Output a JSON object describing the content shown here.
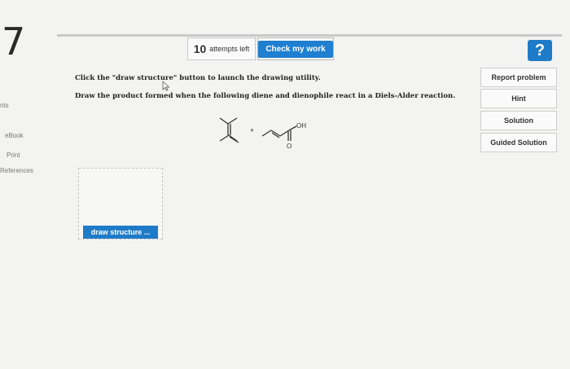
{
  "question": {
    "number": "7"
  },
  "toolbar": {
    "attempts_count": "10",
    "attempts_label": "attempts left",
    "check_label": "Check my work",
    "help_label": "?"
  },
  "sidebar": {
    "items": [
      {
        "label": "nts"
      },
      {
        "label": "eBook"
      },
      {
        "label": "Print"
      },
      {
        "label": "References"
      }
    ]
  },
  "instructions": {
    "line1": "Click the \"draw structure\" button to launch the drawing utility.",
    "line2": "Draw the product formed when the following diene and dienophile react in a Diels-Alder reaction."
  },
  "reaction": {
    "plus": "+",
    "oh_label": "OH",
    "o_label": "O"
  },
  "right_panel": {
    "buttons": [
      {
        "label": "Report problem"
      },
      {
        "label": "Hint"
      },
      {
        "label": "Solution"
      },
      {
        "label": "Guided Solution"
      }
    ]
  },
  "draw": {
    "button_label": "draw structure ..."
  }
}
